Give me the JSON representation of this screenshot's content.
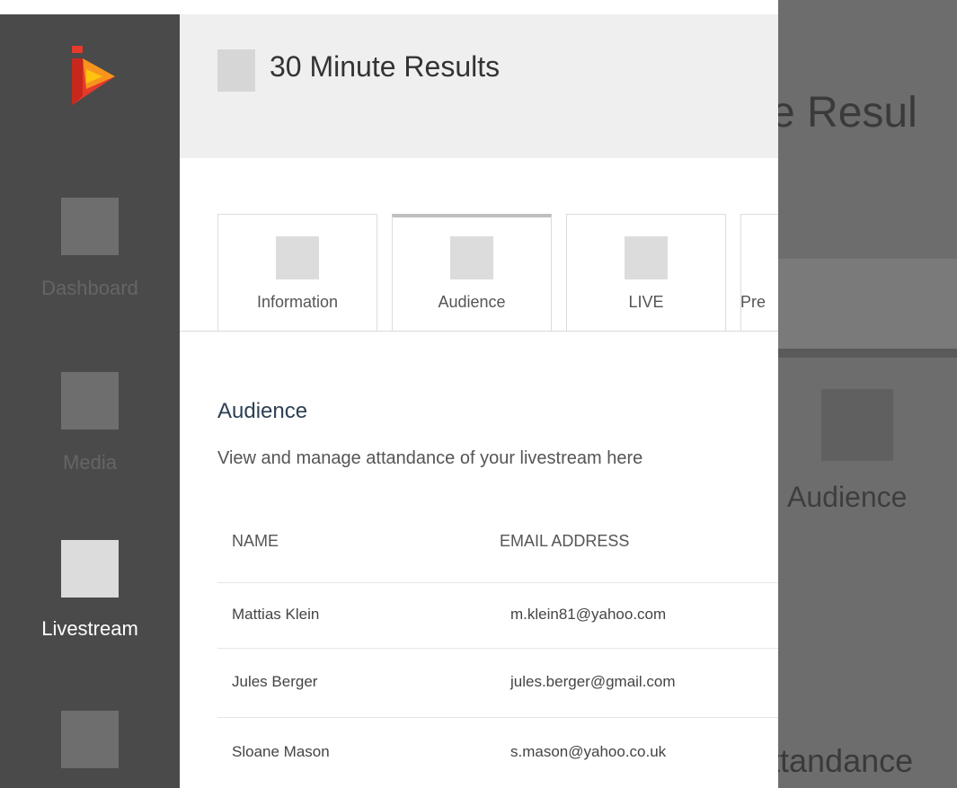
{
  "sidebar": {
    "logo": "play-logo",
    "items": [
      {
        "label": "Dashboard",
        "icon": "dashboard-icon",
        "active": false
      },
      {
        "label": "Media",
        "icon": "media-icon",
        "active": false
      },
      {
        "label": "Livestream",
        "icon": "livestream-icon",
        "active": true
      },
      {
        "label": "",
        "icon": "nav-icon",
        "active": false
      }
    ]
  },
  "header": {
    "title": "30 Minute Results",
    "icon": "event-icon"
  },
  "tabs": [
    {
      "label": "Information",
      "icon": "information-icon"
    },
    {
      "label": "Audience",
      "icon": "audience-icon",
      "active": true
    },
    {
      "label": "LIVE",
      "icon": "live-icon"
    },
    {
      "label": "Pre",
      "icon": "pre-icon"
    }
  ],
  "section": {
    "title": "Audience",
    "description": "View and manage attandance of your livestream here"
  },
  "table": {
    "columns": [
      "NAME",
      "EMAIL ADDRESS"
    ],
    "rows": [
      {
        "name": "Mattias Klein",
        "email": "m.klein81@yahoo.com"
      },
      {
        "name": "Jules Berger",
        "email": "jules.berger@gmail.com"
      },
      {
        "name": "Sloane Mason",
        "email": "s.mason@yahoo.co.uk"
      }
    ]
  },
  "overlay": {
    "title_fragment": "e Resul",
    "audience_label": "Audience",
    "attendance_fragment": "ttandance"
  },
  "colors": {
    "sidebar_bg": "#4a4a4a",
    "header_bg": "#efefef",
    "overlay_bg": "#6d6d6d",
    "logo_red": "#e63a2b",
    "logo_orange": "#f7941d",
    "logo_yellow": "#ffc20e",
    "section_title": "#2d4053"
  }
}
